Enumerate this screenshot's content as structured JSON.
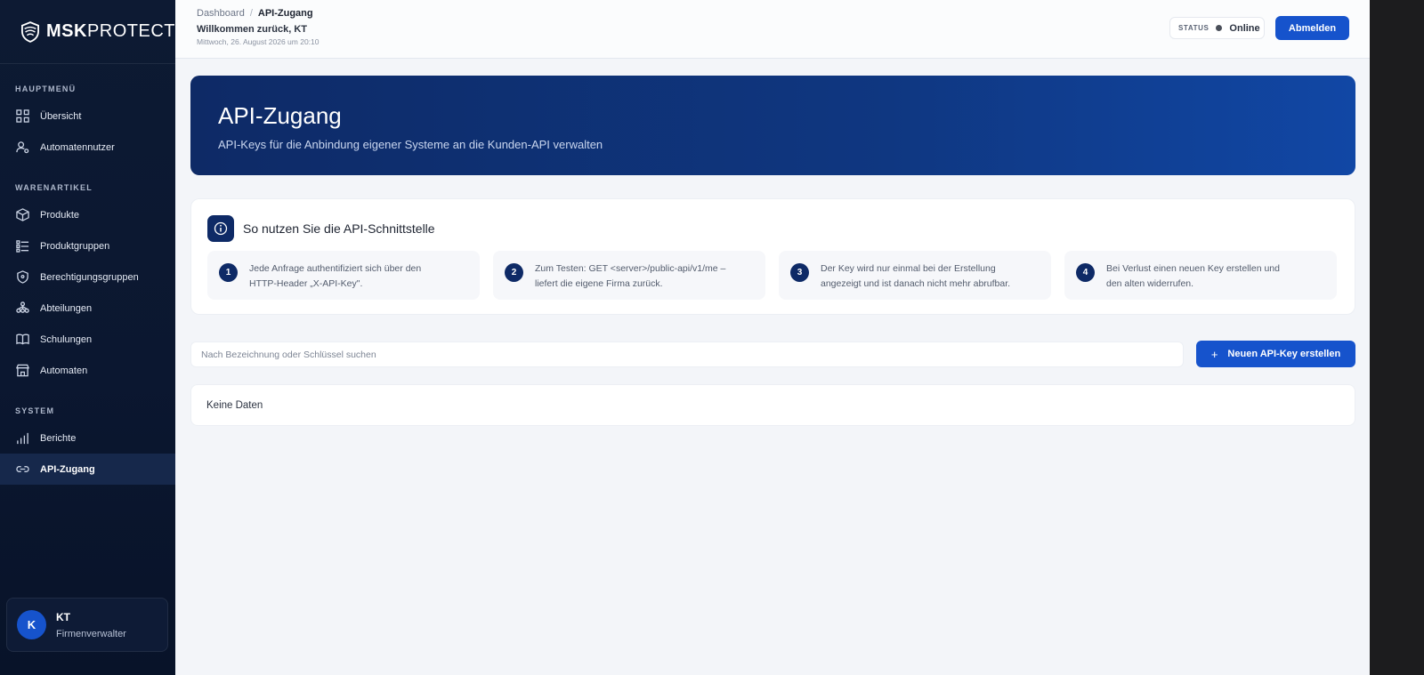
{
  "app": {
    "logo_bold": "MSK",
    "logo_light": "PROTECT"
  },
  "sidebar": {
    "sections": [
      {
        "title": "HAUPTMENÜ",
        "items": [
          {
            "label": "Übersicht",
            "icon": "grid-icon"
          },
          {
            "label": "Automatennutzer",
            "icon": "user-settings-icon"
          }
        ]
      },
      {
        "title": "WARENARTIKEL",
        "items": [
          {
            "label": "Produkte",
            "icon": "box-icon"
          },
          {
            "label": "Produktgruppen",
            "icon": "list-group-icon"
          },
          {
            "label": "Berechtigungsgruppen",
            "icon": "shield-icon"
          },
          {
            "label": "Abteilungen",
            "icon": "org-chart-icon"
          },
          {
            "label": "Schulungen",
            "icon": "book-icon"
          },
          {
            "label": "Automaten",
            "icon": "store-icon"
          }
        ]
      },
      {
        "title": "SYSTEM",
        "items": [
          {
            "label": "Berichte",
            "icon": "bar-chart-icon"
          },
          {
            "label": "API-Zugang",
            "icon": "link-icon",
            "active": true
          }
        ]
      }
    ],
    "user": {
      "initial": "K",
      "name": "KT",
      "role": "Firmenverwalter"
    }
  },
  "header": {
    "breadcrumb_root": "Dashboard",
    "breadcrumb_separator": "/",
    "breadcrumb_current": "API-Zugang",
    "welcome": "Willkommen zurück, KT",
    "date": "Mittwoch, 26. August 2026 um 20:10",
    "status_label": "STATUS",
    "status_value": "Online",
    "logout_label": "Abmelden"
  },
  "hero": {
    "title": "API-Zugang",
    "subtitle": "API-Keys für die Anbindung eigener Systeme an die Kunden-API verwalten"
  },
  "info": {
    "title": "So nutzen Sie die API-Schnittstelle",
    "steps": [
      {
        "num": "1",
        "line1": "Jede Anfrage authentifiziert sich über den",
        "line2": "HTTP-Header „X-API-Key\"."
      },
      {
        "num": "2",
        "line1": "Zum Testen: GET <server>/public-api/v1/me –",
        "line2": "liefert die eigene Firma zurück."
      },
      {
        "num": "3",
        "line1": "Der Key wird nur einmal bei der Erstellung",
        "line2": "angezeigt und ist danach nicht mehr abrufbar."
      },
      {
        "num": "4",
        "line1": "Bei Verlust einen neuen Key erstellen und",
        "line2": "den alten widerrufen."
      }
    ]
  },
  "search": {
    "placeholder": "Nach Bezeichnung oder Schlüssel suchen",
    "value": ""
  },
  "create_button": {
    "icon": "+",
    "label": "Neuen API-Key erstellen"
  },
  "table": {
    "empty_text": "Keine Daten"
  },
  "colors": {
    "accent": "#1653cc",
    "sidebar_bg": "#0b1730",
    "hero_start": "#0e2a66",
    "hero_end": "#1147a5"
  }
}
